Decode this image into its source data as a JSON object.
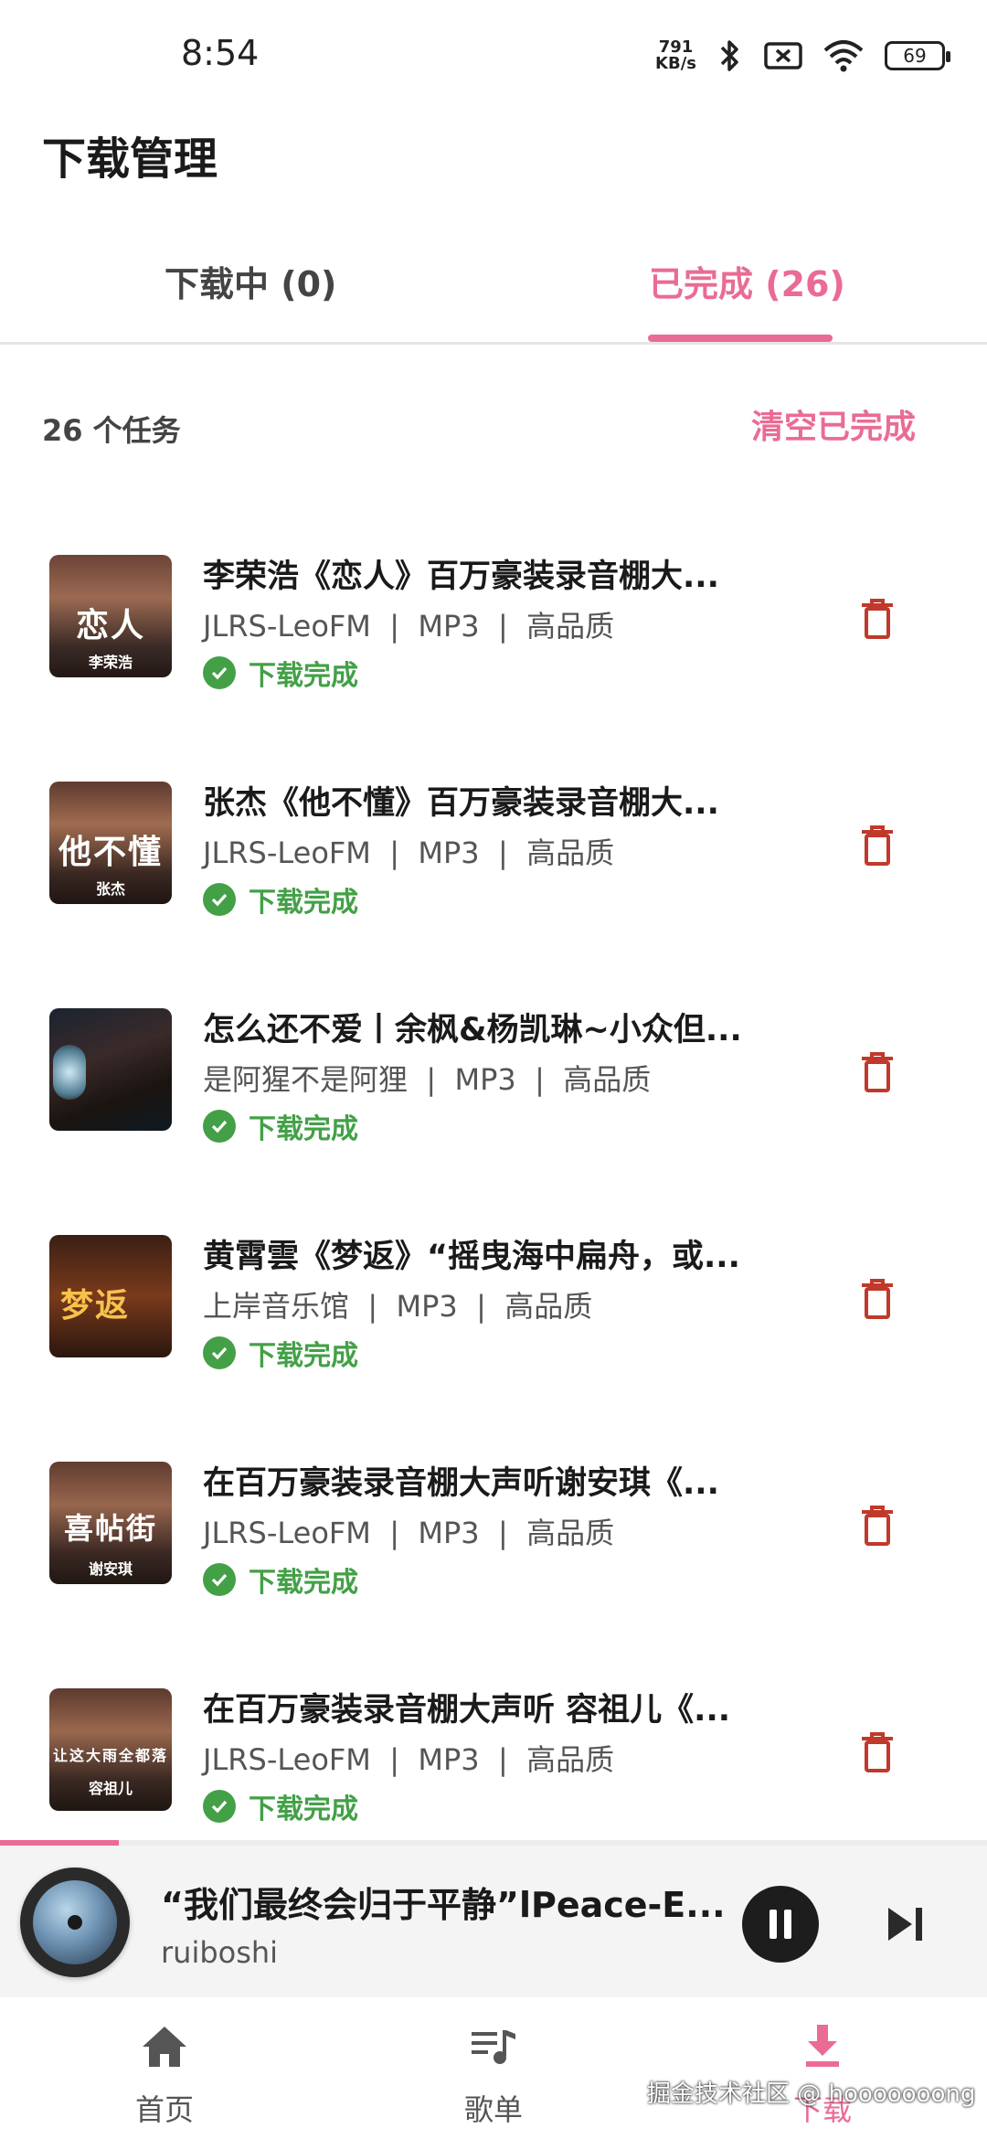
{
  "status_bar": {
    "time": "8:54",
    "net_speed_value": "791",
    "net_speed_unit": "KB/s",
    "battery": "69"
  },
  "header": {
    "title": "下载管理"
  },
  "tabs": [
    {
      "label": "下载中 (0)"
    },
    {
      "label": "已完成 (26)"
    }
  ],
  "summary": {
    "count_text": "26 个任务",
    "clear_label": "清空已完成"
  },
  "items": [
    {
      "title": "李荣浩《恋人》百万豪装录音棚大...",
      "source": "JLRS-LeoFM",
      "format": "MP3",
      "quality": "高品质",
      "status": "下载完成",
      "cover_text": "恋人",
      "cover_sub": "李荣浩"
    },
    {
      "title": "张杰《他不懂》百万豪装录音棚大...",
      "source": "JLRS-LeoFM",
      "format": "MP3",
      "quality": "高品质",
      "status": "下载完成",
      "cover_text": "他不懂",
      "cover_sub": "张杰"
    },
    {
      "title": "怎么还不爱丨余枫&杨凯琳~小众但...",
      "source": "是阿猩不是阿狸",
      "format": "MP3",
      "quality": "高品质",
      "status": "下载完成"
    },
    {
      "title": "黄霄雲《梦返》“摇曳海中扁舟，或...",
      "source": "上岸音乐馆",
      "format": "MP3",
      "quality": "高品质",
      "status": "下载完成",
      "cover_text": "梦返"
    },
    {
      "title": "在百万豪装录音棚大声听谢安琪《...",
      "source": "JLRS-LeoFM",
      "format": "MP3",
      "quality": "高品质",
      "status": "下载完成",
      "cover_text": "喜帖街",
      "cover_sub": "谢安琪"
    },
    {
      "title": "在百万豪装录音棚大声听 容祖儿《...",
      "source": "JLRS-LeoFM",
      "format": "MP3",
      "quality": "高品质",
      "status": "下载完成",
      "cover_text": "让这大雨全都落",
      "cover_sub": "容祖儿"
    }
  ],
  "player": {
    "title": "“我们最终会归于平静”lPeace-E...",
    "artist": "ruiboshi",
    "progress": 0.12
  },
  "nav": [
    {
      "label": "首页",
      "icon": "home-icon"
    },
    {
      "label": "歌单",
      "icon": "playlist-icon"
    },
    {
      "label": "下载",
      "icon": "download-icon"
    }
  ],
  "watermark": "掘金技术社区 @ hooooooong",
  "colors": {
    "accent": "#ea6b93",
    "success": "#43a047",
    "delete": "#c0392b"
  }
}
